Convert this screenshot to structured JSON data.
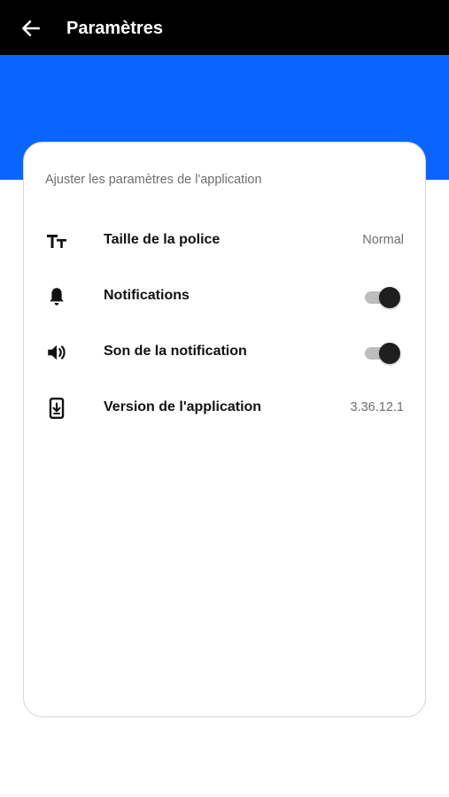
{
  "appbar": {
    "title": "Paramètres",
    "back_icon": "arrow-left-icon"
  },
  "colors": {
    "appbar_bg": "#000000",
    "hero_bg": "#0a65ff",
    "toggle_thumb": "#1f1f1f",
    "toggle_track": "#bdbdbd"
  },
  "card": {
    "subtitle": "Ajuster les paramètres de l'application",
    "rows": [
      {
        "icon": "text-size-icon",
        "label": "Taille de la police",
        "value": "Normal"
      },
      {
        "icon": "bell-icon",
        "label": "Notifications",
        "toggle_on": true
      },
      {
        "icon": "speaker-icon",
        "label": "Son de la notification",
        "toggle_on": true
      },
      {
        "icon": "phone-download-icon",
        "label": "Version de l'application",
        "value": "3.36.12.1"
      }
    ]
  }
}
